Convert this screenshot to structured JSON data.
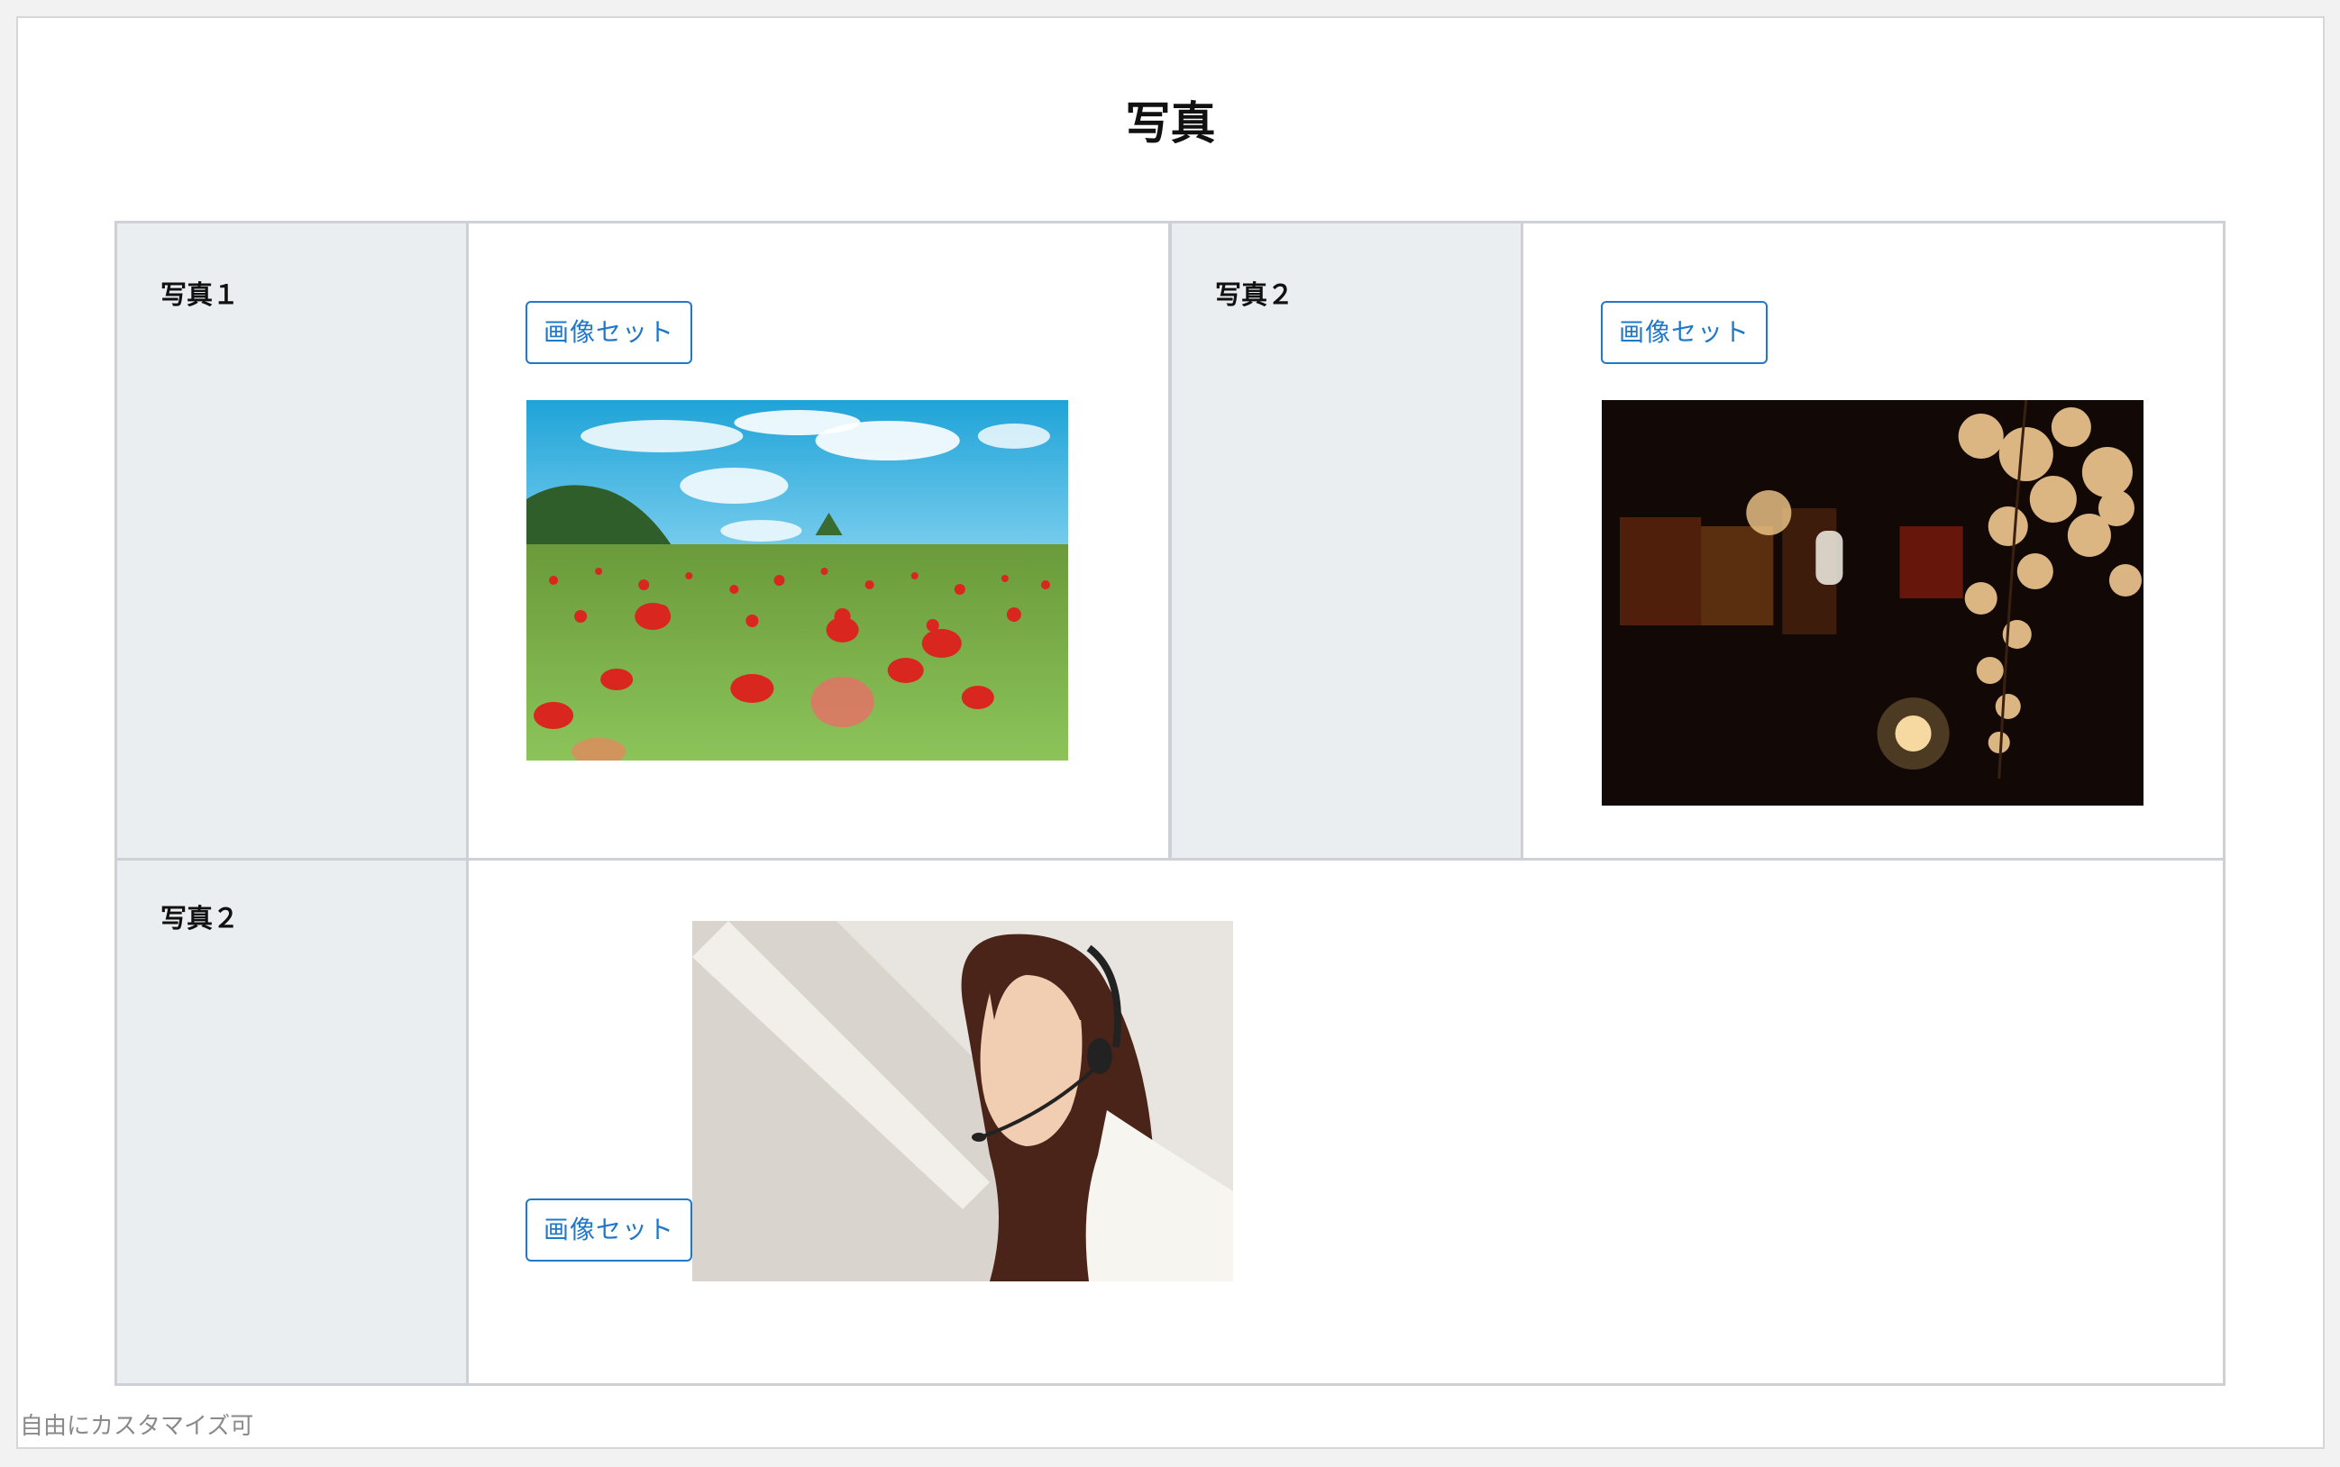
{
  "page": {
    "title": "写真",
    "footer_note": "自由にカスタマイズ可"
  },
  "rows": [
    {
      "cells": [
        {
          "label": "写真１",
          "button_label": "画像セット",
          "image": "poppy-field-photo"
        },
        {
          "label": "写真２",
          "button_label": "画像セット",
          "image": "night-blossom-lanterns-photo"
        }
      ]
    },
    {
      "cells": [
        {
          "label": "写真２",
          "button_label": "画像セット",
          "image": "headset-operator-photo"
        }
      ]
    }
  ],
  "colors": {
    "accent": "#1f78c8",
    "label_bg": "#eaeef1",
    "border": "#cdd1d5"
  }
}
